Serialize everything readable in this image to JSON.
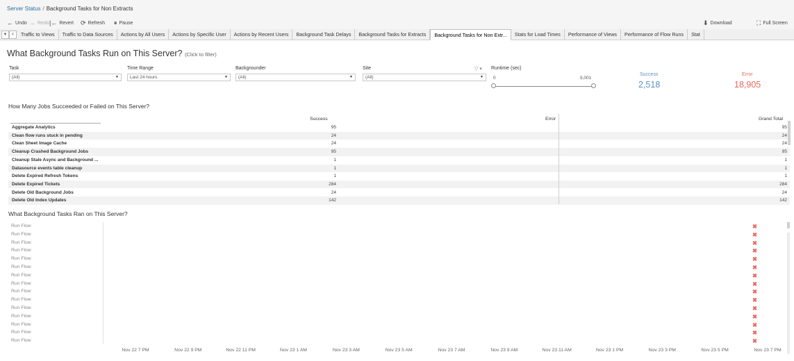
{
  "header": {
    "breadcrumb_root": "Server Status",
    "breadcrumb_sep": "/",
    "breadcrumb_current": "Background Tasks for Non Extracts"
  },
  "toolbar": {
    "undo": "Undo",
    "redo": "Redo",
    "revert": "Revert",
    "refresh": "Refresh",
    "pause": "Pause",
    "download": "Download",
    "fullscreen": "Full Screen"
  },
  "tabs": [
    "Traffic to Views",
    "Traffic to Data Sources",
    "Actions by All Users",
    "Actions by Specific User",
    "Actions by Recent Users",
    "Background Task Delays",
    "Background Tasks for Extracts",
    "Background Tasks for Non Extr...",
    "Stats for Load Times",
    "Performance of Views",
    "Performance of Flow Runs",
    "Stat"
  ],
  "active_tab_index": 7,
  "dashboard": {
    "title": "What Background Tasks Run on This Server?",
    "title_hint": "(Click to filter)"
  },
  "filters": {
    "task": {
      "label": "Task",
      "value": "(All)"
    },
    "time_range": {
      "label": "Time Range",
      "value": "Last 24 hours"
    },
    "backgrounder": {
      "label": "Backgrounder",
      "value": "(All)"
    },
    "site": {
      "label": "Site",
      "value": "(All)"
    },
    "runtime": {
      "label": "Runtime (sec)",
      "min": "0",
      "max": "9,001"
    }
  },
  "kpis": {
    "success_label": "Success",
    "success_value": "2,518",
    "error_label": "Error",
    "error_value": "18,905",
    "success_color": "#5b8fc8",
    "error_color": "#e8685c"
  },
  "jobs_table": {
    "title": "How Many Jobs Succeeded or Failed on This Server?",
    "columns": [
      "Success",
      "Error",
      "Grand Total"
    ],
    "rows": [
      {
        "task": "Aggregate Analytics",
        "success": "95",
        "total": "95"
      },
      {
        "task": "Clean flow runs stuck in pending",
        "success": "24",
        "total": "24"
      },
      {
        "task": "Clean Sheet Image Cache",
        "success": "24",
        "total": "24"
      },
      {
        "task": "Cleanup Crashed Background Jobs",
        "success": "95",
        "total": "95"
      },
      {
        "task": "Cleanup Stale Async and Background ...",
        "success": "1",
        "total": "1"
      },
      {
        "task": "Datasource events table cleanup",
        "success": "1",
        "total": "1"
      },
      {
        "task": "Delete Expired Refresh Tokens",
        "success": "1",
        "total": "1"
      },
      {
        "task": "Delete Expired Tickets",
        "success": "284",
        "total": "284"
      },
      {
        "task": "Delete Old Background Jobs",
        "success": "24",
        "total": "24"
      },
      {
        "task": "Delete Old Index Updates",
        "success": "142",
        "total": "142"
      }
    ]
  },
  "tasks_chart": {
    "title": "What Background Tasks Ran on This Server?",
    "row_label": "Run Flow",
    "row_count": 15,
    "mark_symbol": "✖",
    "x_ticks": [
      "Nov 22 7 PM",
      "Nov 22 9 PM",
      "Nov 22 11 PM",
      "Nov 23 1 AM",
      "Nov 23 3 AM",
      "Nov 23 5 AM",
      "Nov 23 7 AM",
      "Nov 23 9 AM",
      "Nov 23 11 AM",
      "Nov 23 1 PM",
      "Nov 23 3 PM",
      "Nov 23 5 PM",
      "Nov 23 7 PM"
    ]
  }
}
